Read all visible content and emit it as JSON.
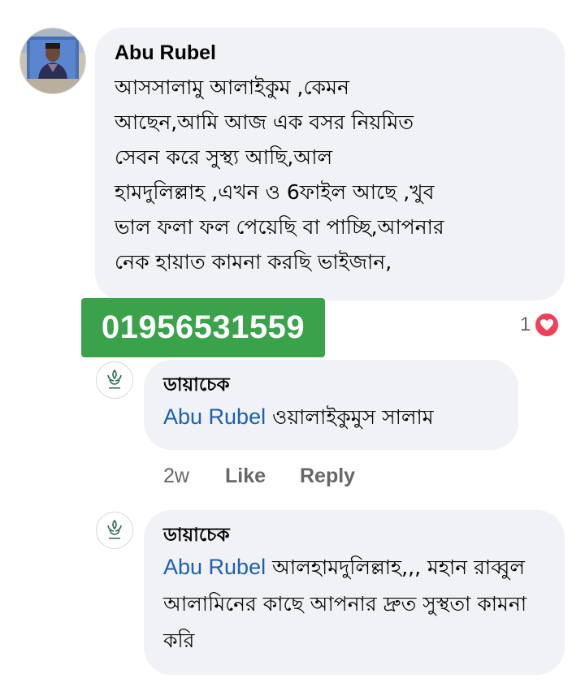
{
  "comment": {
    "author": "Abu Rubel",
    "text": "আসসালামু আলাইকুম ,কেমন\nআছেন,আমি আজ এক বসর নিয়মিত\nসেবন করে সুস্থ্য আছি,আল\nহামদুলিল্লাহ ,এখন ও 6ফাইল আছে ,খুব\nভাল ফলা ফল পেয়েছি বা পাচ্ছি,আপনার\nনেক হায়াত কামনা করছি ভাইজান,",
    "reaction_count": "1",
    "reaction_icon": "heart-icon",
    "reaction_color": "#f33e58"
  },
  "phone_badge": {
    "text": "01956531559",
    "color": "#3aa24b"
  },
  "replies": [
    {
      "author": "ডায়াচেক",
      "mention": "Abu Rubel",
      "text": " ওয়ালাইকুমুস সালাম",
      "time": "2w",
      "like_label": "Like",
      "reply_label": "Reply"
    },
    {
      "author": "ডায়াচেক",
      "mention": "Abu Rubel",
      "text": " আলহামদুলিল্লাহ,,, মহান রাব্বুল আলামিনের কাছে আপনার দ্রুত সুস্থতা কামনা করি"
    }
  ],
  "colors": {
    "bubble": "#f0f2f5",
    "mention": "#1f5fb0",
    "secondary_text": "#65676b",
    "brand_logo": "#2e6b4f"
  }
}
